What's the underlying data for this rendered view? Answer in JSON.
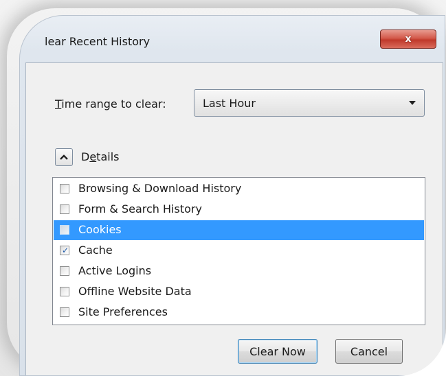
{
  "window": {
    "title": "lear Recent History",
    "close_label": "x"
  },
  "time_range": {
    "label_accel": "T",
    "label_rest": "ime range to clear:",
    "selected": "Last Hour"
  },
  "details": {
    "label_first": "D",
    "label_accel": "e",
    "label_rest": "tails",
    "expanded": true
  },
  "items": [
    {
      "label": "Browsing & Download History",
      "checked": false,
      "selected": false
    },
    {
      "label": "Form & Search History",
      "checked": false,
      "selected": false
    },
    {
      "label": "Cookies",
      "checked": false,
      "selected": true
    },
    {
      "label": "Cache",
      "checked": true,
      "selected": false
    },
    {
      "label": "Active Logins",
      "checked": false,
      "selected": false
    },
    {
      "label": "Offline Website Data",
      "checked": false,
      "selected": false
    },
    {
      "label": "Site Preferences",
      "checked": false,
      "selected": false
    }
  ],
  "buttons": {
    "clear_now": "Clear Now",
    "cancel": "Cancel"
  },
  "colors": {
    "selection": "#3399ff",
    "close_button": "#c0392b"
  }
}
